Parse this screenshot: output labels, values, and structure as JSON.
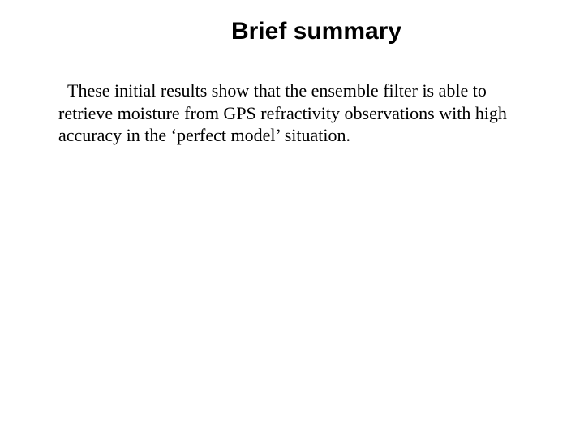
{
  "title": "Brief summary",
  "body": "These initial results show that the ensemble filter is able to retrieve moisture from GPS refractivity observations with high accuracy in the ‘perfect model’ situation."
}
